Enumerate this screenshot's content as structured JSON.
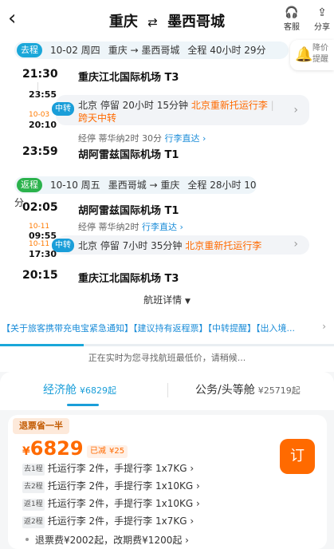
{
  "header": {
    "back_icon": "chevron-left-icon",
    "from": "重庆",
    "to": "墨西哥城",
    "service_label": "客服",
    "share_label": "分享"
  },
  "remind": {
    "label": "降价提醒"
  },
  "outbound": {
    "tag": "去程",
    "date": "10-02 周四",
    "route": "重庆 → 墨西哥城",
    "duration": "全程 40小时 29分",
    "dep_time": "21:30",
    "dep_airport": "重庆江北国际机场 T3",
    "arr1_time": "23:55",
    "dep2_date": "10-03",
    "dep2_time": "20:10",
    "transfer_badge": "中转",
    "transfer_city": "北京",
    "transfer_stay": "停留 20小时 15分钟",
    "transfer_note": "北京重新托运行李",
    "transfer_extra": "跨天中转",
    "via": "经停 蒂华纳2时 30分",
    "via_link": "行李直达",
    "arr_time": "23:59",
    "arr_airport": "胡阿雷兹国际机场 T1"
  },
  "inbound": {
    "tag": "返程",
    "date": "10-10 周五",
    "route": "墨西哥城 → 重庆",
    "duration": "全程 28小时 10分",
    "dep_time": "02:05",
    "dep_airport": "胡阿雷兹国际机场 T1",
    "arr1_date": "10-11",
    "arr1_time": "09:55",
    "dep2_date": "10-11",
    "dep2_time": "17:30",
    "via": "经停 蒂华纳2时",
    "via_link": "行李直达",
    "transfer_badge": "中转",
    "transfer_city": "北京",
    "transfer_stay": "停留 7小时 35分钟",
    "transfer_note": "北京重新托运行李",
    "arr_time": "20:15",
    "arr_airport": "重庆江北国际机场 T3"
  },
  "details_label": "航班详情",
  "notice": "【关于旅客携带充电宝紧急通知】【建议持有返程票】【中转提醒】【出入境...",
  "progress": 0.25,
  "searching_text": "正在实时为您寻找航班最低价，请稍候...",
  "cabins": [
    {
      "name": "经济舱",
      "price": "¥6829起"
    },
    {
      "name": "公务/头等舱",
      "price": "¥25719起"
    }
  ],
  "offer": {
    "refund_tag": "退票省一半",
    "currency": "¥",
    "price": "6829",
    "reduced_label": "已减",
    "reduced_value": "¥25",
    "book_label": "订",
    "baggage": [
      {
        "seg": "去1程",
        "text": "托运行李 2件，手提行李 1x7KG"
      },
      {
        "seg": "去2程",
        "text": "托运行李 2件，手提行李 1x10KG"
      },
      {
        "seg": "返1程",
        "text": "托运行李 2件，手提行李 1x10KG"
      },
      {
        "seg": "返2程",
        "text": "托运行李 2件，手提行李 1x7KG"
      }
    ],
    "fees": "退票费¥2002起，改期费¥1200起"
  },
  "colors": {
    "accent": "#1a9ed9",
    "orange": "#ff6a00",
    "outbound_tag": "#1aa7d9",
    "inbound_tag": "#2bb24c"
  }
}
